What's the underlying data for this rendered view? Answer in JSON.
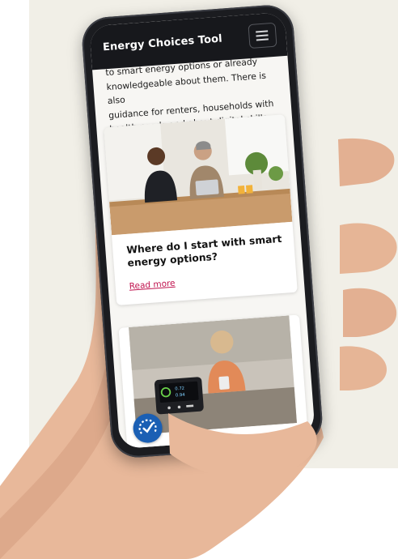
{
  "app": {
    "title": "Energy Choices Tool",
    "menu_icon": "hamburger-menu-icon"
  },
  "intro": {
    "line1": "to smart energy options or already",
    "line2": "knowledgeable about them. There is also",
    "line3": "guidance for renters, households with",
    "line4": "health needs and about digital skills."
  },
  "cards": [
    {
      "image": "couple-at-kitchen-counter-with-laptop",
      "heading": "Where do I start with smart energy options?",
      "link": "Read more"
    },
    {
      "image": "woman-with-phone-and-smart-meter-display",
      "meter_readout": [
        "0.72",
        "0.94"
      ]
    }
  ],
  "badge_icon": "dial-check-icon",
  "colors": {
    "appbar": "#17181c",
    "link": "#c0144f",
    "badge": "#1a5fb4",
    "background_panel": "#f1efe7"
  }
}
